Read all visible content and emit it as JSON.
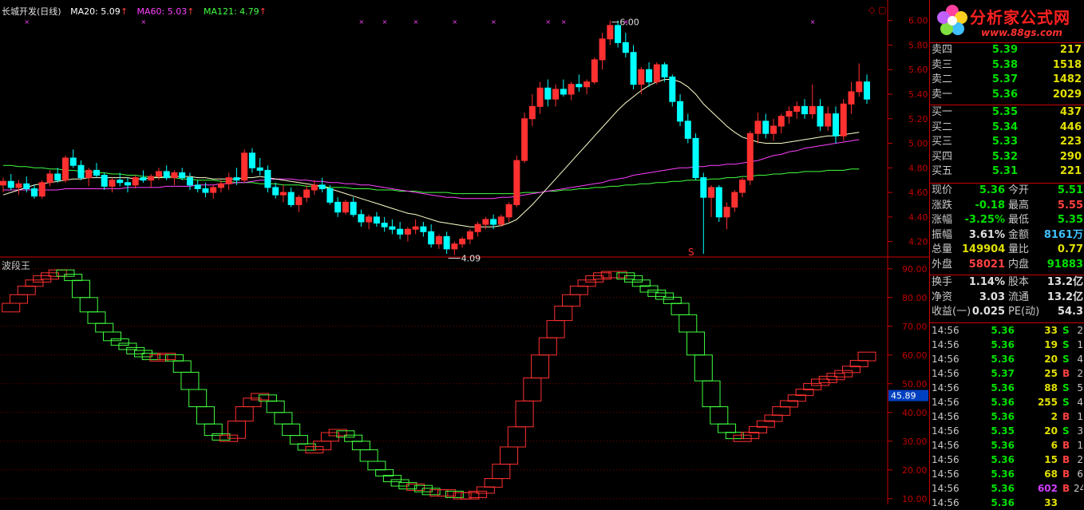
{
  "header": {
    "name": "长城开发(日线)",
    "ma20": "MA20: 5.09",
    "ma60": "MA60: 5.03",
    "ma121": "MA121: 4.79",
    "colors": {
      "ma20": "#ffffff",
      "ma60": "#ff40ff",
      "ma121": "#40ff40",
      "up": "#ff3030",
      "down": "#00ffff"
    }
  },
  "price_axis": [
    "6.00",
    "5.80",
    "5.60",
    "5.40",
    "5.20",
    "5.00",
    "4.80",
    "4.60",
    "4.40",
    "4.20"
  ],
  "annotations": {
    "high": "6.00",
    "low": "4.09",
    "marker": "S"
  },
  "indicator": {
    "title": "波段王",
    "axis": [
      "90.00",
      "80.00",
      "70.00",
      "60.00",
      "50.00",
      "40.00",
      "30.00",
      "20.00",
      "10.00"
    ],
    "current": "45.89"
  },
  "chart_data": {
    "type": "candlestick",
    "ylim": [
      4.1,
      6.05
    ],
    "ohlc": [
      [
        4.66,
        4.72,
        4.6,
        4.69
      ],
      [
        4.69,
        4.75,
        4.62,
        4.64
      ],
      [
        4.64,
        4.7,
        4.58,
        4.67
      ],
      [
        4.67,
        4.73,
        4.6,
        4.63
      ],
      [
        4.63,
        4.66,
        4.55,
        4.57
      ],
      [
        4.57,
        4.7,
        4.55,
        4.68
      ],
      [
        4.68,
        4.78,
        4.65,
        4.75
      ],
      [
        4.75,
        4.8,
        4.68,
        4.7
      ],
      [
        4.7,
        4.9,
        4.68,
        4.88
      ],
      [
        4.88,
        4.95,
        4.8,
        4.82
      ],
      [
        4.82,
        4.86,
        4.7,
        4.72
      ],
      [
        4.72,
        4.8,
        4.65,
        4.78
      ],
      [
        4.78,
        4.84,
        4.72,
        4.74
      ],
      [
        4.74,
        4.76,
        4.62,
        4.65
      ],
      [
        4.65,
        4.72,
        4.6,
        4.7
      ],
      [
        4.7,
        4.76,
        4.65,
        4.68
      ],
      [
        4.68,
        4.72,
        4.6,
        4.66
      ],
      [
        4.66,
        4.74,
        4.63,
        4.72
      ],
      [
        4.72,
        4.78,
        4.68,
        4.7
      ],
      [
        4.7,
        4.75,
        4.64,
        4.73
      ],
      [
        4.73,
        4.8,
        4.7,
        4.77
      ],
      [
        4.77,
        4.82,
        4.7,
        4.72
      ],
      [
        4.72,
        4.78,
        4.66,
        4.76
      ],
      [
        4.76,
        4.8,
        4.7,
        4.72
      ],
      [
        4.72,
        4.76,
        4.62,
        4.66
      ],
      [
        4.66,
        4.7,
        4.6,
        4.63
      ],
      [
        4.63,
        4.68,
        4.56,
        4.6
      ],
      [
        4.6,
        4.66,
        4.55,
        4.64
      ],
      [
        4.64,
        4.7,
        4.6,
        4.67
      ],
      [
        4.67,
        4.76,
        4.62,
        4.72
      ],
      [
        4.72,
        4.8,
        4.66,
        4.7
      ],
      [
        4.7,
        4.95,
        4.68,
        4.92
      ],
      [
        4.92,
        4.96,
        4.76,
        4.8
      ],
      [
        4.8,
        4.88,
        4.74,
        4.78
      ],
      [
        4.78,
        4.82,
        4.6,
        4.64
      ],
      [
        4.64,
        4.68,
        4.55,
        4.58
      ],
      [
        4.58,
        4.66,
        4.52,
        4.6
      ],
      [
        4.6,
        4.64,
        4.48,
        4.5
      ],
      [
        4.5,
        4.58,
        4.44,
        4.56
      ],
      [
        4.56,
        4.66,
        4.52,
        4.62
      ],
      [
        4.62,
        4.7,
        4.58,
        4.66
      ],
      [
        4.66,
        4.72,
        4.6,
        4.63
      ],
      [
        4.63,
        4.66,
        4.5,
        4.52
      ],
      [
        4.52,
        4.56,
        4.4,
        4.44
      ],
      [
        4.44,
        4.54,
        4.42,
        4.52
      ],
      [
        4.52,
        4.56,
        4.4,
        4.42
      ],
      [
        4.42,
        4.46,
        4.32,
        4.36
      ],
      [
        4.36,
        4.42,
        4.3,
        4.4
      ],
      [
        4.4,
        4.44,
        4.32,
        4.35
      ],
      [
        4.35,
        4.4,
        4.28,
        4.32
      ],
      [
        4.32,
        4.38,
        4.26,
        4.3
      ],
      [
        4.3,
        4.36,
        4.22,
        4.26
      ],
      [
        4.26,
        4.32,
        4.2,
        4.3
      ],
      [
        4.3,
        4.38,
        4.26,
        4.32
      ],
      [
        4.32,
        4.36,
        4.24,
        4.28
      ],
      [
        4.28,
        4.34,
        4.15,
        4.18
      ],
      [
        4.18,
        4.26,
        4.14,
        4.24
      ],
      [
        4.24,
        4.28,
        4.1,
        4.14
      ],
      [
        4.14,
        4.2,
        4.09,
        4.18
      ],
      [
        4.18,
        4.24,
        4.15,
        4.22
      ],
      [
        4.22,
        4.3,
        4.18,
        4.28
      ],
      [
        4.28,
        4.36,
        4.24,
        4.34
      ],
      [
        4.34,
        4.4,
        4.3,
        4.38
      ],
      [
        4.38,
        4.42,
        4.3,
        4.34
      ],
      [
        4.34,
        4.42,
        4.32,
        4.4
      ],
      [
        4.4,
        4.52,
        4.36,
        4.5
      ],
      [
        4.5,
        4.9,
        4.48,
        4.86
      ],
      [
        4.86,
        5.25,
        4.84,
        5.2
      ],
      [
        5.2,
        5.4,
        5.14,
        5.3
      ],
      [
        5.3,
        5.5,
        5.24,
        5.45
      ],
      [
        5.45,
        5.52,
        5.3,
        5.36
      ],
      [
        5.36,
        5.48,
        5.3,
        5.44
      ],
      [
        5.44,
        5.52,
        5.38,
        5.4
      ],
      [
        5.4,
        5.5,
        5.35,
        5.48
      ],
      [
        5.48,
        5.56,
        5.42,
        5.46
      ],
      [
        5.46,
        5.52,
        5.4,
        5.5
      ],
      [
        5.5,
        5.7,
        5.48,
        5.68
      ],
      [
        5.68,
        5.9,
        5.6,
        5.85
      ],
      [
        5.85,
        6.0,
        5.8,
        5.96
      ],
      [
        5.96,
        6.0,
        5.78,
        5.82
      ],
      [
        5.82,
        5.9,
        5.7,
        5.74
      ],
      [
        5.74,
        5.8,
        5.44,
        5.48
      ],
      [
        5.48,
        5.62,
        5.4,
        5.6
      ],
      [
        5.6,
        5.66,
        5.46,
        5.5
      ],
      [
        5.5,
        5.66,
        5.48,
        5.64
      ],
      [
        5.64,
        5.66,
        5.5,
        5.54
      ],
      [
        5.54,
        5.56,
        5.3,
        5.34
      ],
      [
        5.34,
        5.4,
        5.14,
        5.18
      ],
      [
        5.18,
        5.24,
        5.0,
        5.04
      ],
      [
        5.04,
        5.08,
        4.7,
        4.72
      ],
      [
        4.72,
        4.76,
        4.1,
        4.56
      ],
      [
        4.56,
        4.66,
        4.4,
        4.64
      ],
      [
        4.64,
        4.66,
        4.36,
        4.4
      ],
      [
        4.4,
        4.52,
        4.3,
        4.48
      ],
      [
        4.48,
        4.62,
        4.44,
        4.6
      ],
      [
        4.6,
        4.72,
        4.56,
        4.7
      ],
      [
        4.7,
        5.1,
        4.66,
        5.08
      ],
      [
        5.08,
        5.25,
        5.0,
        5.18
      ],
      [
        5.18,
        5.24,
        5.04,
        5.08
      ],
      [
        5.08,
        5.2,
        5.02,
        5.14
      ],
      [
        5.14,
        5.24,
        5.08,
        5.22
      ],
      [
        5.22,
        5.3,
        5.16,
        5.26
      ],
      [
        5.26,
        5.34,
        5.2,
        5.3
      ],
      [
        5.3,
        5.36,
        5.2,
        5.24
      ],
      [
        5.24,
        5.48,
        5.2,
        5.3
      ],
      [
        5.3,
        5.36,
        5.1,
        5.14
      ],
      [
        5.14,
        5.3,
        5.1,
        5.24
      ],
      [
        5.24,
        5.3,
        5.0,
        5.06
      ],
      [
        5.06,
        5.36,
        5.02,
        5.32
      ],
      [
        5.32,
        5.5,
        5.24,
        5.42
      ],
      [
        5.42,
        5.65,
        5.38,
        5.5
      ],
      [
        5.5,
        5.56,
        5.32,
        5.36
      ]
    ],
    "ma20": [
      4.58,
      4.6,
      4.62,
      4.64,
      4.66,
      4.67,
      4.68,
      4.69,
      4.7,
      4.71,
      4.71,
      4.72,
      4.72,
      4.72,
      4.72,
      4.72,
      4.72,
      4.71,
      4.71,
      4.72,
      4.72,
      4.73,
      4.73,
      4.73,
      4.73,
      4.72,
      4.72,
      4.71,
      4.71,
      4.71,
      4.71,
      4.72,
      4.72,
      4.73,
      4.72,
      4.71,
      4.7,
      4.69,
      4.68,
      4.67,
      4.66,
      4.65,
      4.63,
      4.61,
      4.59,
      4.57,
      4.55,
      4.53,
      4.51,
      4.49,
      4.47,
      4.45,
      4.43,
      4.42,
      4.4,
      4.38,
      4.36,
      4.35,
      4.34,
      4.33,
      4.32,
      4.32,
      4.32,
      4.32,
      4.33,
      4.35,
      4.38,
      4.44,
      4.5,
      4.57,
      4.64,
      4.71,
      4.78,
      4.85,
      4.92,
      4.99,
      5.06,
      5.13,
      5.2,
      5.27,
      5.33,
      5.38,
      5.43,
      5.47,
      5.5,
      5.52,
      5.52,
      5.5,
      5.46,
      5.4,
      5.32,
      5.26,
      5.2,
      5.14,
      5.09,
      5.05,
      5.03,
      5.01,
      5.0,
      5.0,
      5.0,
      5.01,
      5.02,
      5.03,
      5.04,
      5.05,
      5.06,
      5.06,
      5.07,
      5.08,
      5.09
    ],
    "ma60": [
      4.62,
      4.62,
      4.62,
      4.62,
      4.62,
      4.62,
      4.62,
      4.62,
      4.63,
      4.63,
      4.63,
      4.63,
      4.63,
      4.63,
      4.63,
      4.63,
      4.64,
      4.64,
      4.64,
      4.64,
      4.64,
      4.65,
      4.65,
      4.65,
      4.65,
      4.66,
      4.66,
      4.66,
      4.67,
      4.67,
      4.68,
      4.68,
      4.69,
      4.7,
      4.7,
      4.71,
      4.71,
      4.71,
      4.7,
      4.7,
      4.69,
      4.69,
      4.68,
      4.68,
      4.67,
      4.67,
      4.66,
      4.66,
      4.65,
      4.64,
      4.63,
      4.62,
      4.61,
      4.6,
      4.59,
      4.58,
      4.57,
      4.56,
      4.56,
      4.55,
      4.55,
      4.55,
      4.55,
      4.55,
      4.56,
      4.56,
      4.57,
      4.58,
      4.59,
      4.6,
      4.61,
      4.62,
      4.63,
      4.64,
      4.65,
      4.66,
      4.67,
      4.68,
      4.7,
      4.71,
      4.72,
      4.74,
      4.75,
      4.76,
      4.77,
      4.78,
      4.79,
      4.8,
      4.8,
      4.81,
      4.81,
      4.82,
      4.82,
      4.83,
      4.83,
      4.84,
      4.85,
      4.86,
      4.88,
      4.9,
      4.91,
      4.93,
      4.94,
      4.96,
      4.97,
      4.98,
      4.99,
      5.0,
      5.01,
      5.02,
      5.03
    ],
    "ma121": [
      4.82,
      4.82,
      4.81,
      4.81,
      4.8,
      4.8,
      4.79,
      4.79,
      4.78,
      4.78,
      4.77,
      4.77,
      4.76,
      4.76,
      4.75,
      4.75,
      4.74,
      4.74,
      4.73,
      4.73,
      4.72,
      4.72,
      4.72,
      4.71,
      4.71,
      4.7,
      4.7,
      4.7,
      4.69,
      4.69,
      4.68,
      4.68,
      4.68,
      4.67,
      4.67,
      4.67,
      4.66,
      4.66,
      4.66,
      4.65,
      4.65,
      4.65,
      4.64,
      4.64,
      4.64,
      4.63,
      4.63,
      4.63,
      4.62,
      4.62,
      4.62,
      4.61,
      4.61,
      4.61,
      4.6,
      4.6,
      4.6,
      4.6,
      4.59,
      4.59,
      4.59,
      4.59,
      4.59,
      4.59,
      4.59,
      4.59,
      4.59,
      4.6,
      4.6,
      4.6,
      4.61,
      4.61,
      4.62,
      4.62,
      4.63,
      4.63,
      4.64,
      4.64,
      4.65,
      4.65,
      4.66,
      4.66,
      4.67,
      4.67,
      4.68,
      4.68,
      4.69,
      4.69,
      4.7,
      4.7,
      4.7,
      4.71,
      4.71,
      4.72,
      4.72,
      4.73,
      4.73,
      4.74,
      4.74,
      4.75,
      4.75,
      4.76,
      4.76,
      4.77,
      4.77,
      4.77,
      4.78,
      4.78,
      4.78,
      4.79,
      4.79
    ],
    "indicator_ylim": [
      8,
      93
    ],
    "indicator_values": [
      75,
      78,
      81,
      84,
      86,
      87,
      88,
      89,
      88,
      86,
      80,
      75,
      71,
      68,
      65,
      64,
      62,
      61,
      60,
      59,
      59,
      60,
      58,
      54,
      48,
      42,
      36,
      32,
      31,
      31,
      37,
      42,
      45,
      46,
      44,
      40,
      36,
      32,
      29,
      27,
      27,
      30,
      33,
      33,
      32,
      30,
      27,
      23,
      20,
      18,
      16,
      15,
      14,
      14,
      13,
      12,
      12,
      12,
      11,
      11,
      11,
      12,
      14,
      17,
      22,
      28,
      35,
      44,
      52,
      60,
      66,
      72,
      77,
      81,
      84,
      86,
      87,
      88,
      88,
      88,
      87,
      86,
      84,
      82,
      81,
      80,
      78,
      74,
      68,
      60,
      51,
      42,
      36,
      33,
      31,
      31,
      33,
      35,
      37,
      39,
      42,
      44,
      46,
      48,
      50,
      51,
      52,
      53,
      54,
      56,
      58,
      61
    ]
  },
  "logo": {
    "title": "分析家公式网",
    "url": "www.88gs.com"
  },
  "orderbook": [
    {
      "label": "卖四",
      "price": "5.39",
      "vol": "217"
    },
    {
      "label": "卖三",
      "price": "5.38",
      "vol": "1518"
    },
    {
      "label": "卖二",
      "price": "5.37",
      "vol": "1482"
    },
    {
      "label": "卖一",
      "price": "5.36",
      "vol": "2029"
    },
    {
      "label": "买一",
      "price": "5.35",
      "vol": "437"
    },
    {
      "label": "买二",
      "price": "5.34",
      "vol": "446"
    },
    {
      "label": "买三",
      "price": "5.33",
      "vol": "223"
    },
    {
      "label": "买四",
      "price": "5.32",
      "vol": "290"
    },
    {
      "label": "买五",
      "price": "5.31",
      "vol": "221"
    }
  ],
  "quote": [
    {
      "l1": "现价",
      "v1": "5.36",
      "c1": "green",
      "l2": "今开",
      "v2": "5.51",
      "c2": "green"
    },
    {
      "l1": "涨跌",
      "v1": "-0.18",
      "c1": "green",
      "l2": "最高",
      "v2": "5.55",
      "c2": "red"
    },
    {
      "l1": "涨幅",
      "v1": "-3.25%",
      "c1": "green",
      "l2": "最低",
      "v2": "5.35",
      "c2": "green"
    },
    {
      "l1": "振幅",
      "v1": "3.61%",
      "c1": "white",
      "l2": "金额",
      "v2": "8161万",
      "c2": "cyan"
    },
    {
      "l1": "总量",
      "v1": "149904",
      "c1": "yellow",
      "l2": "量比",
      "v2": "0.77",
      "c2": "yellow"
    },
    {
      "l1": "外盘",
      "v1": "58021",
      "c1": "red",
      "l2": "内盘",
      "v2": "91883",
      "c2": "green"
    }
  ],
  "quote2": [
    {
      "l1": "换手",
      "v1": "1.14%",
      "c1": "white",
      "l2": "股本",
      "v2": "13.2亿",
      "c2": "white"
    },
    {
      "l1": "净资",
      "v1": "3.03",
      "c1": "white",
      "l2": "流通",
      "v2": "13.2亿",
      "c2": "white"
    },
    {
      "l1": "收益(一)",
      "v1": "0.025",
      "c1": "white",
      "l2": "PE(动)",
      "v2": "54.3",
      "c2": "white"
    }
  ],
  "ticks": [
    {
      "t": "14:56",
      "p": "5.36",
      "v": "33",
      "s": "S",
      "sc": "green",
      "n": "2"
    },
    {
      "t": "14:56",
      "p": "5.36",
      "v": "19",
      "s": "S",
      "sc": "green",
      "n": "1"
    },
    {
      "t": "14:56",
      "p": "5.36",
      "v": "20",
      "s": "S",
      "sc": "green",
      "n": "4"
    },
    {
      "t": "14:56",
      "p": "5.37",
      "v": "25",
      "s": "B",
      "sc": "red",
      "n": "2"
    },
    {
      "t": "14:56",
      "p": "5.36",
      "v": "88",
      "s": "S",
      "sc": "green",
      "n": "5"
    },
    {
      "t": "14:56",
      "p": "5.36",
      "v": "255",
      "s": "S",
      "sc": "green",
      "n": "4"
    },
    {
      "t": "14:56",
      "p": "5.36",
      "v": "2",
      "s": "B",
      "sc": "red",
      "n": "1"
    },
    {
      "t": "14:56",
      "p": "5.35",
      "v": "20",
      "s": "S",
      "sc": "green",
      "n": "3"
    },
    {
      "t": "14:56",
      "p": "5.36",
      "v": "6",
      "s": "B",
      "sc": "red",
      "n": "1"
    },
    {
      "t": "14:56",
      "p": "5.36",
      "v": "15",
      "s": "B",
      "sc": "red",
      "n": "2"
    },
    {
      "t": "14:56",
      "p": "5.36",
      "v": "68",
      "s": "B",
      "sc": "red",
      "n": "6"
    },
    {
      "t": "14:56",
      "p": "5.36",
      "v": "602",
      "s": "B",
      "sc": "red",
      "n": "24",
      "vc": "purple"
    },
    {
      "t": "14:56",
      "p": "5.36",
      "v": "33",
      "s": "",
      "sc": "green",
      "n": ""
    }
  ]
}
